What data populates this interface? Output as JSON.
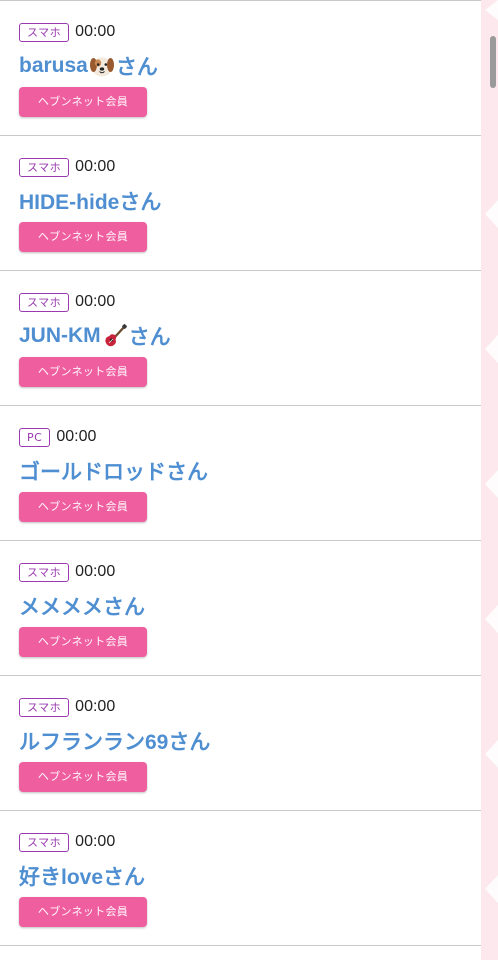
{
  "colors": {
    "name_link": "#4f8fd1",
    "device_badge": "#9b3ab0",
    "member_button": "#ef5fa0",
    "side_panel": "#fde8ee"
  },
  "entries": [
    {
      "device": "スマホ",
      "time": "00:00",
      "name_prefix": "barusa",
      "emoji": "dog-face-emoji",
      "name_suffix": "さん",
      "member": "ヘブンネット会員"
    },
    {
      "device": "スマホ",
      "time": "00:00",
      "name_prefix": "HIDE-hideさん",
      "emoji": "",
      "name_suffix": "",
      "member": "ヘブンネット会員"
    },
    {
      "device": "スマホ",
      "time": "00:00",
      "name_prefix": "JUN-KM",
      "emoji": "guitar-emoji",
      "name_suffix": "さん",
      "member": "ヘブンネット会員"
    },
    {
      "device": "PC",
      "time": "00:00",
      "name_prefix": "ゴールドロッドさん",
      "emoji": "",
      "name_suffix": "",
      "member": "ヘブンネット会員"
    },
    {
      "device": "スマホ",
      "time": "00:00",
      "name_prefix": "メメメメさん",
      "emoji": "",
      "name_suffix": "",
      "member": "ヘブンネット会員"
    },
    {
      "device": "スマホ",
      "time": "00:00",
      "name_prefix": "ルフランラン69さん",
      "emoji": "",
      "name_suffix": "",
      "member": "ヘブンネット会員"
    },
    {
      "device": "スマホ",
      "time": "00:00",
      "name_prefix": "好きloveさん",
      "emoji": "",
      "name_suffix": "",
      "member": "ヘブンネット会員"
    }
  ]
}
